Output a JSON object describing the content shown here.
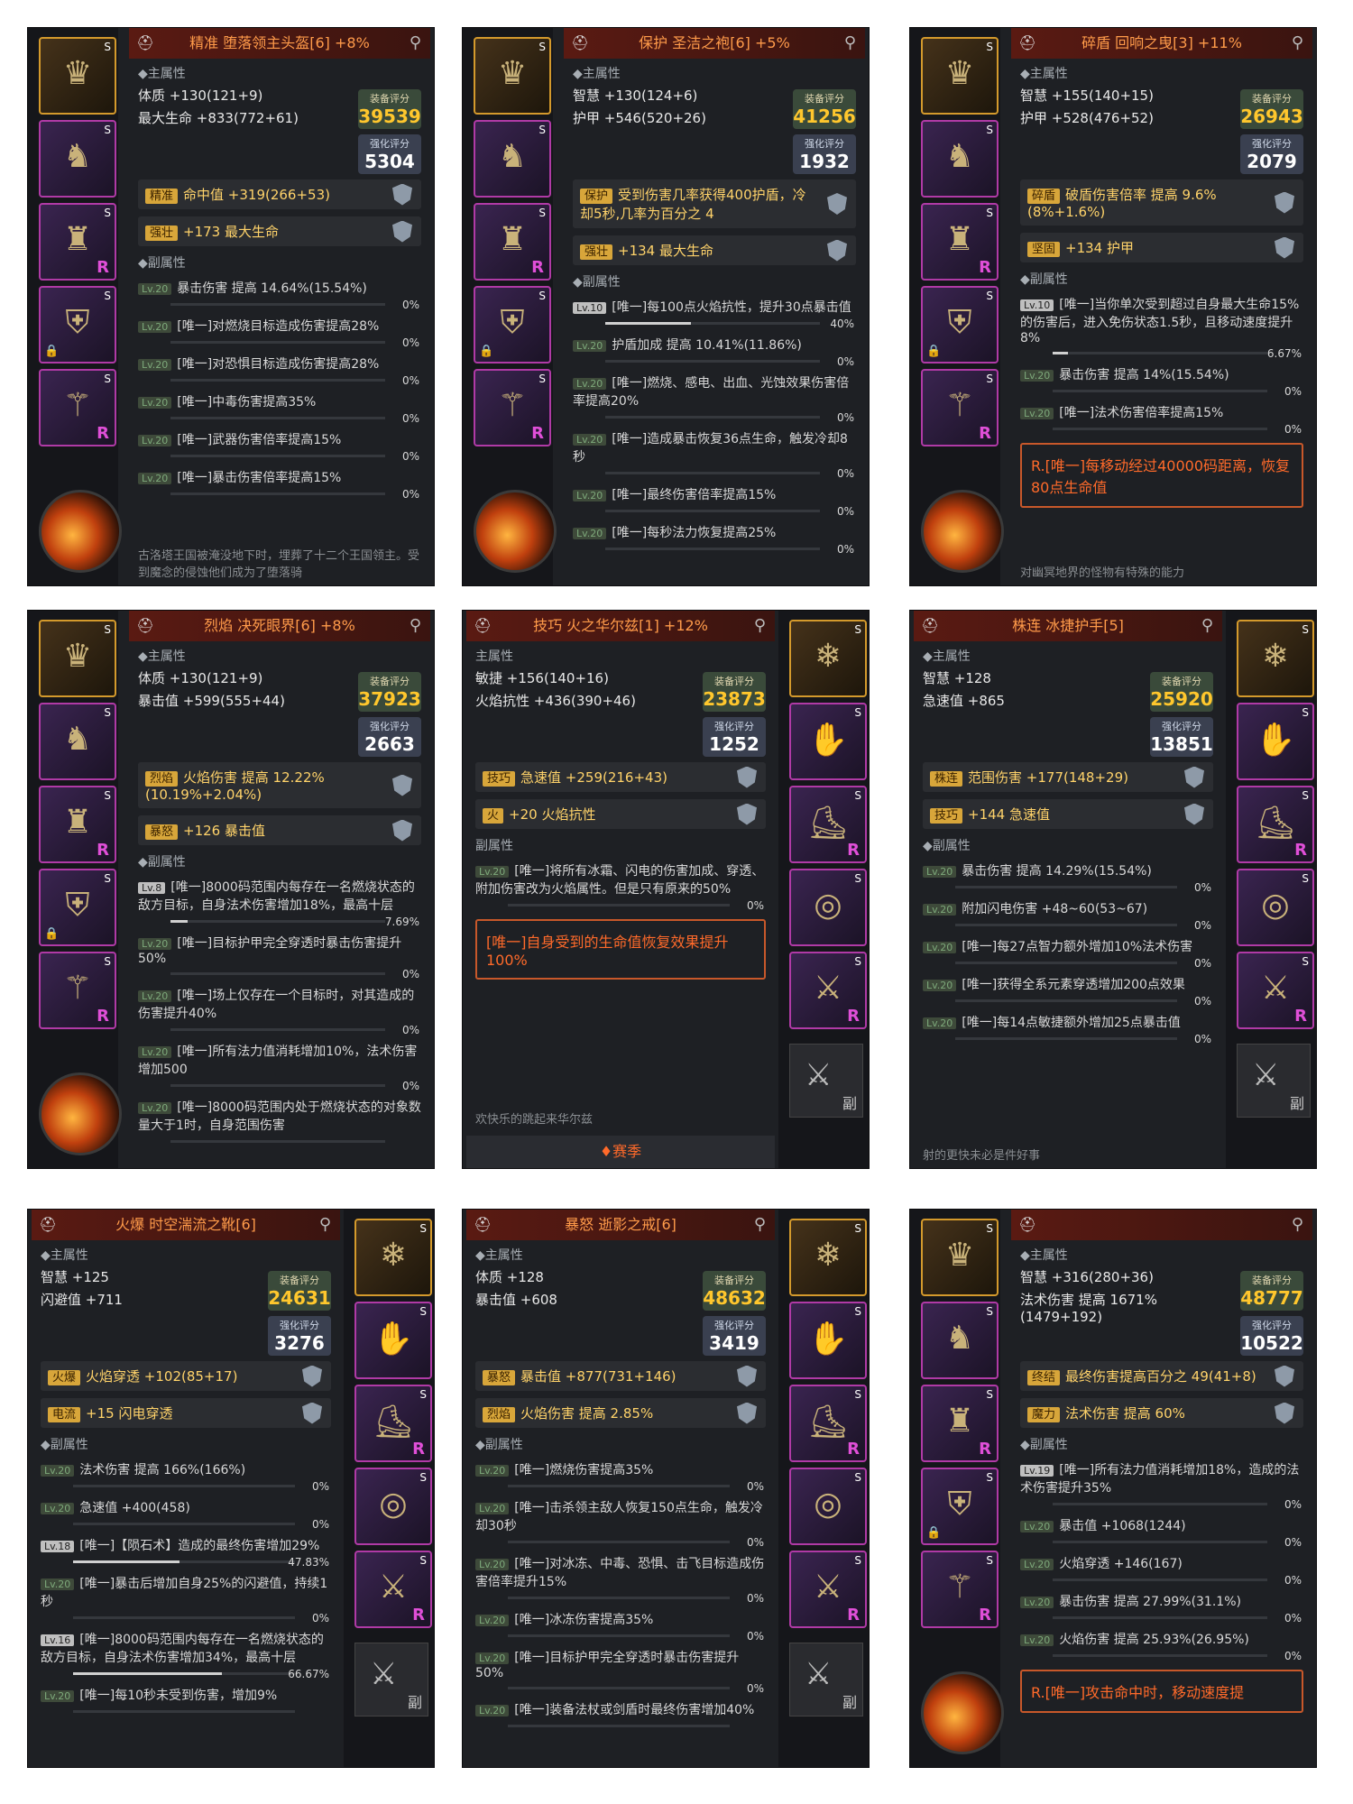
{
  "panels": [
    {
      "title": "精准 堕落领主头盔[6] +8%",
      "main_header": "◆主属性",
      "main_lines": [
        "体质 +130(121+9)",
        "最大生命 +833(772+61)"
      ],
      "equip_score_label": "装备评分",
      "equip_score": "39539",
      "enhance_score_label": "强化评分",
      "enhance_score": "5304",
      "affixes": [
        {
          "tag": "精准",
          "text": "命中值 +319(266+53)"
        },
        {
          "tag": "强壮",
          "text": "+173 最大生命"
        }
      ],
      "sub_header": "◆副属性",
      "subs": [
        {
          "lv": "Lv.20",
          "text": "暴击伤害 提高 14.64%(15.54%)",
          "pct": "0%",
          "fill": 0
        },
        {
          "lv": "Lv.20",
          "text": "[唯一]对燃烧目标造成伤害提高28%",
          "pct": "0%",
          "fill": 0
        },
        {
          "lv": "Lv.20",
          "text": "[唯一]对恐惧目标造成伤害提高28%",
          "pct": "0%",
          "fill": 0
        },
        {
          "lv": "Lv.20",
          "text": "[唯一]中毒伤害提高35%",
          "pct": "0%",
          "fill": 0
        },
        {
          "lv": "Lv.20",
          "text": "[唯一]武器伤害倍率提高15%",
          "pct": "0%",
          "fill": 0
        },
        {
          "lv": "Lv.20",
          "text": "[唯一]暴击伤害倍率提高15%",
          "pct": "0%",
          "fill": 0
        }
      ],
      "lore": "古洛塔王国被淹没地下时，埋葬了十二个王国领主。受到魔念的侵蚀他们成为了堕落骑"
    },
    {
      "title": "保护 圣洁之袍[6] +5%",
      "main_header": "◆主属性",
      "main_lines": [
        "智慧 +130(124+6)",
        "护甲 +546(520+26)"
      ],
      "equip_score_label": "装备评分",
      "equip_score": "41256",
      "enhance_score_label": "强化评分",
      "enhance_score": "1932",
      "affixes": [
        {
          "tag": "保护",
          "text": "受到伤害几率获得400护盾，冷却5秒,几率为百分之 4"
        },
        {
          "tag": "强壮",
          "text": "+134 最大生命"
        }
      ],
      "sub_header": "◆副属性",
      "subs": [
        {
          "lv": "Lv.10",
          "text": "[唯一]每100点火焰抗性，提升30点暴击值",
          "pct": "40%",
          "fill": 40
        },
        {
          "lv": "Lv.20",
          "text": "护盾加成 提高 10.41%(11.86%)",
          "pct": "0%",
          "fill": 0
        },
        {
          "lv": "Lv.20",
          "text": "[唯一]燃烧、感电、出血、光蚀效果伤害倍率提高20%",
          "pct": "0%",
          "fill": 0
        },
        {
          "lv": "Lv.20",
          "text": "[唯一]造成暴击恢复36点生命，触发冷却8秒",
          "pct": "0%",
          "fill": 0
        },
        {
          "lv": "Lv.20",
          "text": "[唯一]最终伤害倍率提高15%",
          "pct": "0%",
          "fill": 0
        },
        {
          "lv": "Lv.20",
          "text": "[唯一]每秒法力恢复提高25%",
          "pct": "0%",
          "fill": 0
        }
      ],
      "lore": ""
    },
    {
      "title": "碎盾 回响之曳[3] +11%",
      "main_header": "◆主属性",
      "main_lines": [
        "智慧 +155(140+15)",
        "护甲 +528(476+52)"
      ],
      "equip_score_label": "装备评分",
      "equip_score": "26943",
      "enhance_score_label": "强化评分",
      "enhance_score": "2079",
      "affixes": [
        {
          "tag": "碎盾",
          "text": "破盾伤害倍率 提高 9.6%(8%+1.6%)"
        },
        {
          "tag": "坚固",
          "text": "+134 护甲"
        }
      ],
      "sub_header": "◆副属性",
      "subs": [
        {
          "lv": "Lv.10",
          "text": "[唯一]当你单次受到超过自身最大生命15%的伤害后，进入免伤状态1.5秒，且移动速度提升8%",
          "pct": "6.67%",
          "fill": 7
        },
        {
          "lv": "Lv.20",
          "text": "暴击伤害 提高 14%(15.54%)",
          "pct": "0%",
          "fill": 0
        },
        {
          "lv": "Lv.20",
          "text": "[唯一]法术伤害倍率提高15%",
          "pct": "0%",
          "fill": 0
        }
      ],
      "season": "R.[唯一]每移动经过40000码距离，恢复80点生命值",
      "lore": "对幽冥地界的怪物有特殊的能力"
    },
    {
      "title": "烈焰 决死眼界[6] +8%",
      "main_header": "◆主属性",
      "main_lines": [
        "体质 +130(121+9)",
        "暴击值 +599(555+44)"
      ],
      "equip_score_label": "装备评分",
      "equip_score": "37923",
      "enhance_score_label": "强化评分",
      "enhance_score": "2663",
      "affixes": [
        {
          "tag": "烈焰",
          "text": "火焰伤害 提高 12.22%(10.19%+2.04%)"
        },
        {
          "tag": "暴怒",
          "text": "+126 暴击值"
        }
      ],
      "sub_header": "◆副属性",
      "subs": [
        {
          "lv": "Lv.8",
          "text": "[唯一]8000码范围内每存在一名燃烧状态的敌方目标，自身法术伤害增加18%，最高十层",
          "pct": "7.69%",
          "fill": 8
        },
        {
          "lv": "Lv.20",
          "text": "[唯一]目标护甲完全穿透时暴击伤害提升50%",
          "pct": "0%",
          "fill": 0
        },
        {
          "lv": "Lv.20",
          "text": "[唯一]场上仅存在一个目标时，对其造成的伤害提升40%",
          "pct": "0%",
          "fill": 0
        },
        {
          "lv": "Lv.20",
          "text": "[唯一]所有法力值消耗增加10%，法术伤害增加500",
          "pct": "0%",
          "fill": 0
        },
        {
          "lv": "Lv.20",
          "text": "[唯一]8000码范围内处于燃烧状态的对象数量大于1时，自身范围伤害",
          "pct": "",
          "fill": 0
        }
      ],
      "lore": ""
    },
    {
      "title": "技巧 火之华尔兹[1] +12%",
      "main_header": "主属性",
      "main_lines": [
        "敏捷 +156(140+16)",
        "火焰抗性 +436(390+46)"
      ],
      "equip_score_label": "装备评分",
      "equip_score": "23873",
      "enhance_score_label": "强化评分",
      "enhance_score": "1252",
      "affixes": [
        {
          "tag": "技巧",
          "text": "急速值 +259(216+43)"
        },
        {
          "tag": "火",
          "text": "+20 火焰抗性"
        }
      ],
      "sub_header": "副属性",
      "subs": [
        {
          "lv": "Lv.20",
          "text": "[唯一]将所有冰霜、闪电的伤害加成、穿透、附加伤害改为火焰属性。但是只有原来的50%",
          "pct": "0%",
          "fill": 0
        }
      ],
      "season": "[唯一]自身受到的生命值恢复效果提升100%",
      "lore": "欢快乐的跳起来华尔兹",
      "season_btn": "♦赛季"
    },
    {
      "title": "株连 冰捷护手[5]",
      "main_header": "◆主属性",
      "main_lines": [
        "智慧 +128",
        "急速值 +865"
      ],
      "equip_score_label": "装备评分",
      "equip_score": "25920",
      "enhance_score_label": "强化评分",
      "enhance_score": "13851",
      "affixes": [
        {
          "tag": "株连",
          "text": "范围伤害 +177(148+29)"
        },
        {
          "tag": "技巧",
          "text": "+144 急速值"
        }
      ],
      "sub_header": "◆副属性",
      "subs": [
        {
          "lv": "Lv.20",
          "text": "暴击伤害 提高 14.29%(15.54%)",
          "pct": "0%",
          "fill": 0
        },
        {
          "lv": "Lv.20",
          "text": "附加闪电伤害 +48~60(53~67)",
          "pct": "0%",
          "fill": 0
        },
        {
          "lv": "Lv.20",
          "text": "[唯一]每27点智力额外增加10%法术伤害",
          "pct": "0%",
          "fill": 0
        },
        {
          "lv": "Lv.20",
          "text": "[唯一]获得全系元素穿透增加200点效果",
          "pct": "0%",
          "fill": 0
        },
        {
          "lv": "Lv.20",
          "text": "[唯一]每14点敏捷额外增加25点暴击值",
          "pct": "0%",
          "fill": 0
        }
      ],
      "lore": "射的更快未必是件好事"
    },
    {
      "title": "火爆 时空湍流之靴[6]",
      "main_header": "◆主属性",
      "main_lines": [
        "智慧 +125",
        "闪避值 +711"
      ],
      "equip_score_label": "装备评分",
      "equip_score": "24631",
      "enhance_score_label": "强化评分",
      "enhance_score": "3276",
      "affixes": [
        {
          "tag": "火爆",
          "text": "火焰穿透 +102(85+17)"
        },
        {
          "tag": "电流",
          "text": "+15 闪电穿透"
        }
      ],
      "sub_header": "◆副属性",
      "subs": [
        {
          "lv": "Lv.20",
          "text": "法术伤害 提高 166%(166%)",
          "pct": "0%",
          "fill": 0
        },
        {
          "lv": "Lv.20",
          "text": "急速值 +400(458)",
          "pct": "0%",
          "fill": 0
        },
        {
          "lv": "Lv.18",
          "text": "[唯一]【陨石术】造成的最终伤害增加29%",
          "pct": "47.83%",
          "fill": 48
        },
        {
          "lv": "Lv.20",
          "text": "[唯一]暴击后增加自身25%的闪避值，持续1秒",
          "pct": "0%",
          "fill": 0
        },
        {
          "lv": "Lv.16",
          "text": "[唯一]8000码范围内每存在一名燃烧状态的敌方目标，自身法术伤害增加34%，最高十层",
          "pct": "66.67%",
          "fill": 67
        },
        {
          "lv": "Lv.20",
          "text": "[唯一]每10秒未受到伤害，增加9%",
          "pct": "",
          "fill": 0
        }
      ],
      "lore": ""
    },
    {
      "title": "暴怒 逝影之戒[6]",
      "main_header": "◆主属性",
      "main_lines": [
        "体质 +128",
        "暴击值 +608"
      ],
      "equip_score_label": "装备评分",
      "equip_score": "48632",
      "enhance_score_label": "强化评分",
      "enhance_score": "3419",
      "affixes": [
        {
          "tag": "暴怒",
          "text": "暴击值 +877(731+146)"
        },
        {
          "tag": "烈焰",
          "text": "火焰伤害 提高 2.85%"
        }
      ],
      "sub_header": "◆副属性",
      "subs": [
        {
          "lv": "Lv.20",
          "text": "[唯一]燃烧伤害提高35%",
          "pct": "0%",
          "fill": 0
        },
        {
          "lv": "Lv.20",
          "text": "[唯一]击杀领主敌人恢复150点生命，触发冷却30秒",
          "pct": "0%",
          "fill": 0
        },
        {
          "lv": "Lv.20",
          "text": "[唯一]对冰冻、中毒、恐惧、击飞目标造成伤害倍率提升15%",
          "pct": "0%",
          "fill": 0
        },
        {
          "lv": "Lv.20",
          "text": "[唯一]冰冻伤害提高35%",
          "pct": "0%",
          "fill": 0
        },
        {
          "lv": "Lv.20",
          "text": "[唯一]目标护甲完全穿透时暴击伤害提升50%",
          "pct": "0%",
          "fill": 0
        },
        {
          "lv": "Lv.20",
          "text": "[唯一]装备法杖或剑盾时最终伤害增加40%",
          "pct": "",
          "fill": 0
        }
      ],
      "lore": ""
    },
    {
      "title": "",
      "main_header": "◆主属性",
      "main_lines": [
        "智慧 +316(280+36)",
        "法术伤害 提高 1671%(1479+192)"
      ],
      "equip_score_label": "装备评分",
      "equip_score": "48777",
      "enhance_score_label": "强化评分",
      "enhance_score": "10522",
      "affixes": [
        {
          "tag": "终结",
          "text": "最终伤害提高百分之 49(41+8)"
        },
        {
          "tag": "魔力",
          "text": "法术伤害 提高 60%"
        }
      ],
      "sub_header": "◆副属性",
      "subs": [
        {
          "lv": "Lv.19",
          "text": "[唯一]所有法力值消耗增加18%，造成的法术伤害提升35%",
          "pct": "0%",
          "fill": 0
        },
        {
          "lv": "Lv.20",
          "text": "暴击值 +1068(1244)",
          "pct": "0%",
          "fill": 0
        },
        {
          "lv": "Lv.20",
          "text": "火焰穿透 +146(167)",
          "pct": "0%",
          "fill": 0
        },
        {
          "lv": "Lv.20",
          "text": "暴击伤害 提高 27.99%(31.1%)",
          "pct": "0%",
          "fill": 0
        },
        {
          "lv": "Lv.20",
          "text": "火焰伤害 提高 25.93%(26.95%)",
          "pct": "0%",
          "fill": 0
        }
      ],
      "season": "R.[唯一]攻击命中时，移动速度提",
      "lore": ""
    }
  ],
  "side_button_label": "副"
}
